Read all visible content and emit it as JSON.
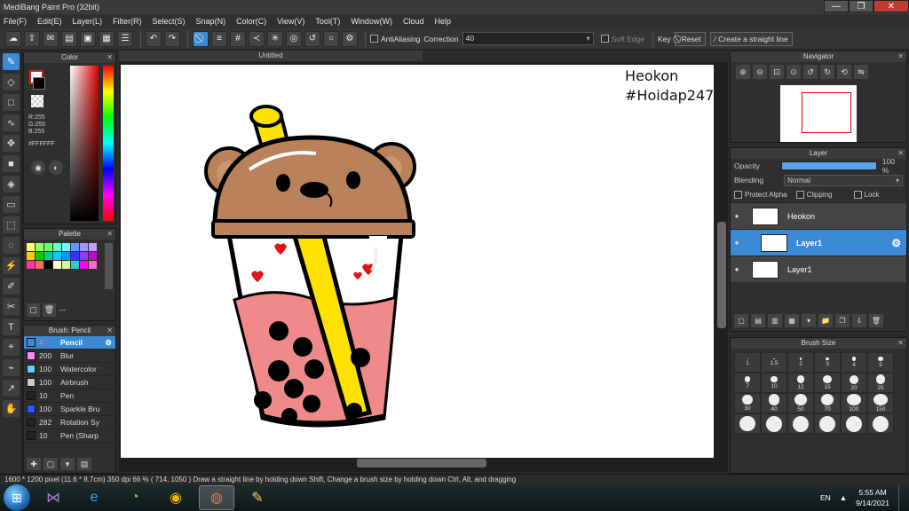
{
  "window": {
    "title": "MediBang Paint Pro (32bit)",
    "minimize": "—",
    "maximize": "❐",
    "close": "✕"
  },
  "menu": [
    "File(F)",
    "Edit(E)",
    "Layer(L)",
    "Filter(R)",
    "Select(S)",
    "Snap(N)",
    "Color(C)",
    "View(V)",
    "Tool(T)",
    "Window(W)",
    "Cloud",
    "Help"
  ],
  "toolbar": {
    "antialiasing": "AntiAliasing",
    "correction_label": "Correction",
    "correction_value": "40",
    "soft_edge": "Soft Edge",
    "key_label": "Key",
    "reset": "Reset",
    "straight_line": "Create a straight line"
  },
  "color_panel": {
    "title": "Color",
    "r": "R:255",
    "g": "G:255",
    "b": "B:255",
    "hex": "#FFFFFF"
  },
  "palette_panel": {
    "title": "Palette",
    "footer_label": "---",
    "colors": [
      "#ffff66",
      "#99ff66",
      "#66ff66",
      "#66ffcc",
      "#66ffff",
      "#6699ff",
      "#9999ff",
      "#cc99ff",
      "#ffcc00",
      "#00cc00",
      "#00cc99",
      "#00ccff",
      "#0099ff",
      "#3333ff",
      "#9933ff",
      "#cc00cc",
      "#ff3399",
      "#ff6666",
      "#000000",
      "#ffffcc",
      "#ccff99",
      "#33cccc",
      "#ff00ff",
      "#ff66cc"
    ]
  },
  "brush_panel": {
    "title": "Brush: Pencil",
    "items": [
      {
        "size": "4",
        "name": "Pencil",
        "color": "#3a8ad6",
        "active": true
      },
      {
        "size": "200",
        "name": "Blur",
        "color": "#ff88ff",
        "active": false
      },
      {
        "size": "100",
        "name": "Watercolor",
        "color": "#66ccff",
        "active": false
      },
      {
        "size": "100",
        "name": "Airbrush",
        "color": "#cccccc",
        "active": false
      },
      {
        "size": "10",
        "name": "Pen",
        "color": "#222222",
        "active": false
      },
      {
        "size": "100",
        "name": "Sparkle Bru",
        "color": "#3355ff",
        "active": false
      },
      {
        "size": "282",
        "name": "Rotation Sy",
        "color": "#222222",
        "active": false
      },
      {
        "size": "10",
        "name": "Pen (Sharp",
        "color": "#222222",
        "active": false
      }
    ]
  },
  "document": {
    "tab": "Untitled",
    "watermark_line1": "Heokon",
    "watermark_line2": "#Hoidap247"
  },
  "navigator": {
    "title": "Navigator"
  },
  "layer_panel": {
    "title": "Layer",
    "opacity_label": "Opacity",
    "opacity_value": "100 %",
    "opacity_fraction": 1.0,
    "blending_label": "Blending",
    "blending_value": "Normal",
    "protect_alpha": "Protect Alpha",
    "clipping": "Clipping",
    "lock": "Lock",
    "layers": [
      {
        "name": "Heokon",
        "selected": false,
        "sub": false
      },
      {
        "name": "Layer1",
        "selected": true,
        "sub": true
      },
      {
        "name": "Layer1",
        "selected": false,
        "sub": false
      }
    ]
  },
  "brush_size": {
    "title": "Brush Size",
    "sizes": [
      "1",
      "1.5",
      "2",
      "3",
      "4",
      "5",
      "7",
      "10",
      "12",
      "15",
      "20",
      "25",
      "30",
      "40",
      "50",
      "70",
      "100",
      "150",
      "",
      "",
      "",
      "",
      "",
      ""
    ]
  },
  "status": {
    "text": "1600 * 1200 pixel  (11.6 * 8.7cm)  350 dpi  66 %  ( 714, 1050 )  Draw a straight line by holding down Shift, Change a brush size by holding down Ctrl, Alt, and dragging"
  },
  "taskbar": {
    "lang": "EN",
    "time": "5:55 AM",
    "date": "9/14/2021"
  }
}
